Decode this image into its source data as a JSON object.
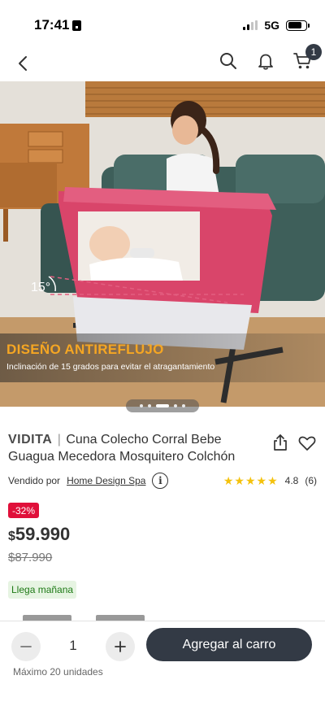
{
  "status_bar": {
    "time": "17:41",
    "network": "5G"
  },
  "nav": {
    "cart_count": "1"
  },
  "hero": {
    "angle_label": "15°",
    "banner_title": "DISEÑO ANTIREFLUJO",
    "banner_subtitle": "Inclinación de 15 grados para evitar el atragantamiento",
    "slides_total": 5,
    "active_slide": 3
  },
  "product": {
    "brand": "VIDITA",
    "separator": "|",
    "title": "Cuna Colecho Corral Bebe Guagua Mecedora Mosquitero Colchón",
    "seller_prefix": "Vendido por",
    "seller_name": "Home Design Spa",
    "info_symbol": "i",
    "rating_stars": "★★★★★",
    "rating_value": "4.8",
    "rating_count": "(6)",
    "discount": "-32%",
    "price_currency": "$",
    "price": "59.990",
    "old_price": "$87.990",
    "delivery": "Llega mañana"
  },
  "purchase": {
    "quantity": "1",
    "add_to_cart": "Agregar al carro",
    "max_units": "Máximo 20 unidades"
  },
  "colors": {
    "accent_dark": "#333a45",
    "discount_red": "#e0103a",
    "delivery_green": "#1e7a16",
    "crib_pink": "#d9456a",
    "banner_orange": "#f5a623"
  }
}
